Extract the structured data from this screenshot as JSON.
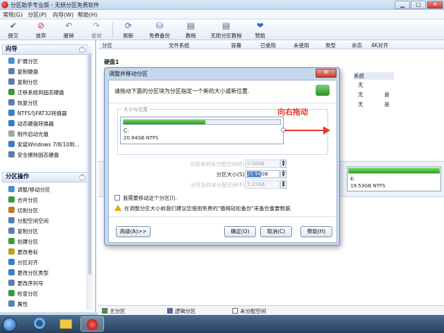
{
  "window": {
    "title": "分区助手专业版 - 无损分区免费软件",
    "min": "▁",
    "max": "□",
    "close": "✕"
  },
  "menu": [
    "常规(G)",
    "分区(P)",
    "向导(W)",
    "帮助(H)"
  ],
  "toolbar": [
    {
      "label": "提交",
      "icon": "check-icon",
      "color": "#2e8b2e",
      "glyph": "✔"
    },
    {
      "label": "放弃",
      "icon": "discard-icon",
      "color": "#c23",
      "glyph": "⊘"
    },
    {
      "label": "撤销",
      "icon": "undo-icon",
      "color": "#2a6",
      "glyph": "↶"
    },
    {
      "label": "重做",
      "icon": "redo-icon",
      "color": "#999",
      "glyph": "↷"
    },
    {
      "label": "刷新",
      "icon": "refresh-icon",
      "color": "#36c",
      "glyph": "⟳"
    },
    {
      "label": "免费备份",
      "icon": "backup-icon",
      "color": "#36c",
      "glyph": "⛁"
    },
    {
      "label": "教程",
      "icon": "tutorial-icon",
      "color": "#467",
      "glyph": "▤"
    },
    {
      "label": "无损分区教程",
      "icon": "lossless-tutorial-icon",
      "color": "#467",
      "glyph": "▤"
    },
    {
      "label": "赞助",
      "icon": "heart-icon",
      "color": "#36c",
      "glyph": "❤"
    }
  ],
  "wizard_panel": {
    "title": "向导",
    "items": [
      "扩展分区",
      "复制硬盘",
      "复制分区",
      "迁移系统到固态硬盘",
      "恢复分区",
      "NTFS与FAT32转换器",
      "动态硬盘转换器",
      "制作启动光盘",
      "安装Windows 7/8/10到...",
      "安全擦除固态硬盘"
    ]
  },
  "ops_panel": {
    "title": "分区操作",
    "items": [
      "调整/移动分区",
      "合并分区",
      "切割分区",
      "分配空闲空间",
      "复制分区",
      "创建分区",
      "更改卷标",
      "分区对齐",
      "更改分区类型",
      "更改序列号",
      "检查分区",
      "属性"
    ]
  },
  "columns": [
    "分区",
    "文件系统",
    "容量",
    "已使用",
    "未使用",
    "类型",
    "状态",
    "4K对齐"
  ],
  "disk_label": "硬盘1",
  "bg_table": {
    "header": "系统",
    "col_a": [
      "无",
      "无",
      "无"
    ],
    "col_b": [
      "是",
      "是"
    ]
  },
  "disk_e": {
    "label": "E:",
    "size": "19.53GB NTFS"
  },
  "legend": [
    "主分区",
    "逻辑分区",
    "未分配空间"
  ],
  "dialog": {
    "title": "调整并移动分区",
    "close": "✕",
    "instruction": "请拖动下面的分区块为分区指定一个新的大小或新位置.",
    "group_label": "大小与位置",
    "annotation": "向右拖动",
    "partition": {
      "label": "C:",
      "size": "20.94GB NTFS",
      "used_fraction": 0.52
    },
    "fields": [
      {
        "label": "分区前的未分配空间(B):",
        "value": "0.00KB",
        "enabled": false
      },
      {
        "label": "分区大小(S):",
        "value": "20.94GB",
        "selected": "20.94",
        "suffix": "GB",
        "enabled": true
      },
      {
        "label": "分区后的未分配空间(F):",
        "value": "7.25GB",
        "enabled": false
      }
    ],
    "checkbox": "我需要移动这个分区(I).",
    "tip": "在调整分区大小前我们建议您使用免费的\"傲梅轻松备份\"来备份重要数据.",
    "buttons": {
      "advanced": "高级(A)>>",
      "ok": "确定(O)",
      "cancel": "取消(C)",
      "help": "帮助(H)"
    }
  }
}
